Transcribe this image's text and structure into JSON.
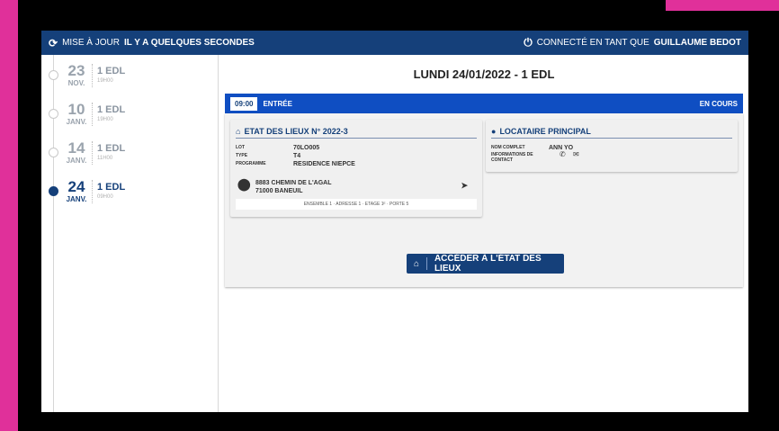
{
  "topbar": {
    "update_prefix": "MISE À JOUR",
    "update_time": "IL Y A QUELQUES SECONDES",
    "connected_prefix": "CONNECTÉ EN TANT QUE",
    "user_name": "GUILLAUME BEDOT"
  },
  "timeline": [
    {
      "day": "23",
      "month": "NOV.",
      "count": "1 EDL",
      "time": "19H00",
      "active": false
    },
    {
      "day": "10",
      "month": "JANV.",
      "count": "1 EDL",
      "time": "19H00",
      "active": false
    },
    {
      "day": "14",
      "month": "JANV.",
      "count": "1 EDL",
      "time": "11H00",
      "active": false
    },
    {
      "day": "24",
      "month": "JANV.",
      "count": "1 EDL",
      "time": "09H00",
      "active": true
    }
  ],
  "main": {
    "title": "LUNDI 24/01/2022 - 1 EDL",
    "appointment": {
      "time": "09:00",
      "type": "ENTRÉE",
      "status": "EN COURS"
    },
    "edl_card": {
      "title": "ETAT DES LIEUX N° 2022-3",
      "lot_label": "LOT",
      "lot_value": "70LO005",
      "type_label": "TYPE",
      "type_value": "T4",
      "programme_label": "PROGRAMME",
      "programme_value": "RESIDENCE NIEPCE",
      "address_line1": "8883 CHEMIN DE L'AGAL",
      "address_line2": "71000 BANEUIL",
      "sub_info": "ENSEMBLE 1 · ADRESSE 1 · ETAGE 1ᴱ · PORTE 5"
    },
    "locataire_card": {
      "title": "LOCATAIRE PRINCIPAL",
      "name_label": "NOM COMPLET",
      "name_value": "ANN YO",
      "contact_label_1": "INFORMATIONS DE",
      "contact_label_2": "CONTACT"
    },
    "access_button": "ACCÉDER À L'ÉTAT DES LIEUX"
  },
  "colors": {
    "navy": "#15407a",
    "blue": "#0f4ec2",
    "pink": "#e0309a"
  }
}
